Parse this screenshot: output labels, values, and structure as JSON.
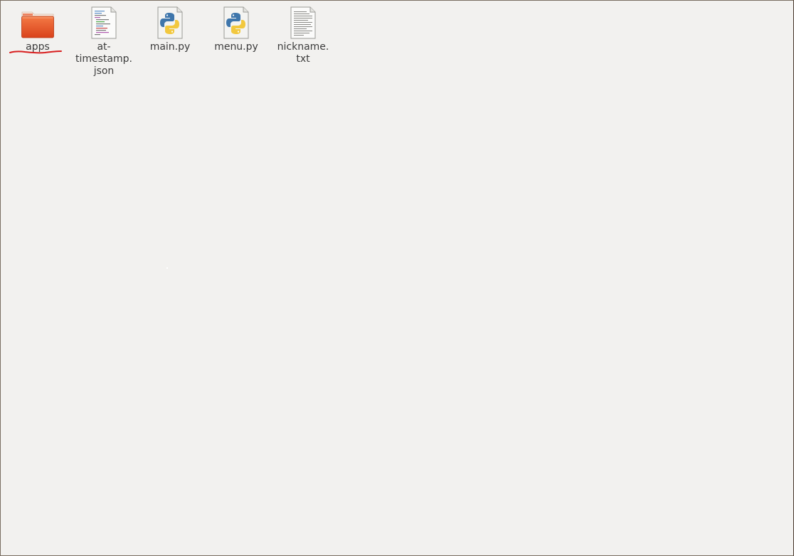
{
  "files": [
    {
      "name": "apps",
      "type": "folder",
      "icon": "folder-icon"
    },
    {
      "name": "at-\ntimestamp.\njson",
      "type": "json",
      "icon": "json-file-icon"
    },
    {
      "name": "main.py",
      "type": "python",
      "icon": "python-file-icon"
    },
    {
      "name": "menu.py",
      "type": "python",
      "icon": "python-file-icon"
    },
    {
      "name": "nickname.\ntxt",
      "type": "text",
      "icon": "text-file-icon"
    }
  ],
  "colors": {
    "background": "#f2f1ef",
    "folder": "#e8572a",
    "annotation": "#d81e1e",
    "label": "#3c3c3c"
  }
}
